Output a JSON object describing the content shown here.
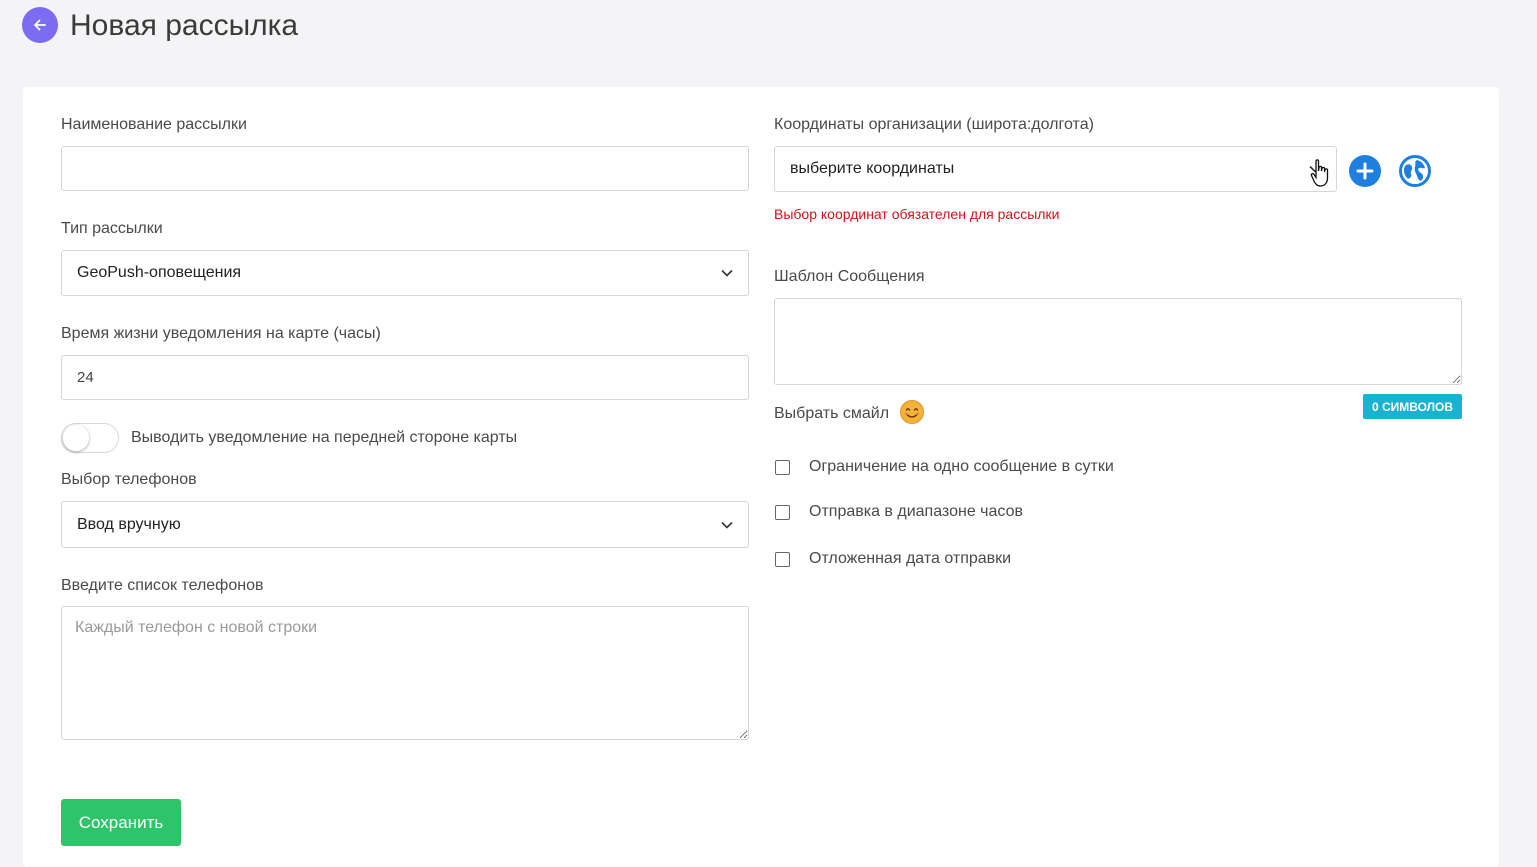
{
  "header": {
    "title": "Новая рассылка"
  },
  "form": {
    "name_label": "Наименование рассылки",
    "name_value": "",
    "type_label": "Тип рассылки",
    "type_value": "GeoPush-оповещения",
    "lifetime_label": "Время жизни уведомления на карте (часы)",
    "lifetime_value": "24",
    "front_toggle_label": "Выводить уведомление на передней стороне карты",
    "front_toggle_on": false,
    "phones_select_label": "Выбор телефонов",
    "phones_select_value": "Ввод вручную",
    "phones_list_label": "Введите список телефонов",
    "phones_list_placeholder": "Каждый телефон с новой строки",
    "coords_label": "Координаты организации (широта:долгота)",
    "coords_value": "выберите координаты",
    "coords_error": "Выбор координат обязателен для рассылки",
    "template_label": "Шаблон Сообщения",
    "template_value": "",
    "char_count": "0 СИМВОЛОВ",
    "emoji_label": "Выбрать смайл",
    "checkbox_one_per_day": "Ограничение на одно сообщение в сутки",
    "checkbox_hour_range": "Отправка в диапазоне часов",
    "checkbox_delayed": "Отложенная дата отправки",
    "save_label": "Сохранить"
  },
  "colors": {
    "accent": "#7c6cf2",
    "save": "#2ec46a",
    "error": "#d4111a",
    "badge": "#17b3d1",
    "action_blue": "#1e7fe0"
  },
  "icons": [
    "arrow-left-icon",
    "chevron-down-icon",
    "plus-icon",
    "globe-icon",
    "smile-icon",
    "hand-pointer-icon"
  ]
}
